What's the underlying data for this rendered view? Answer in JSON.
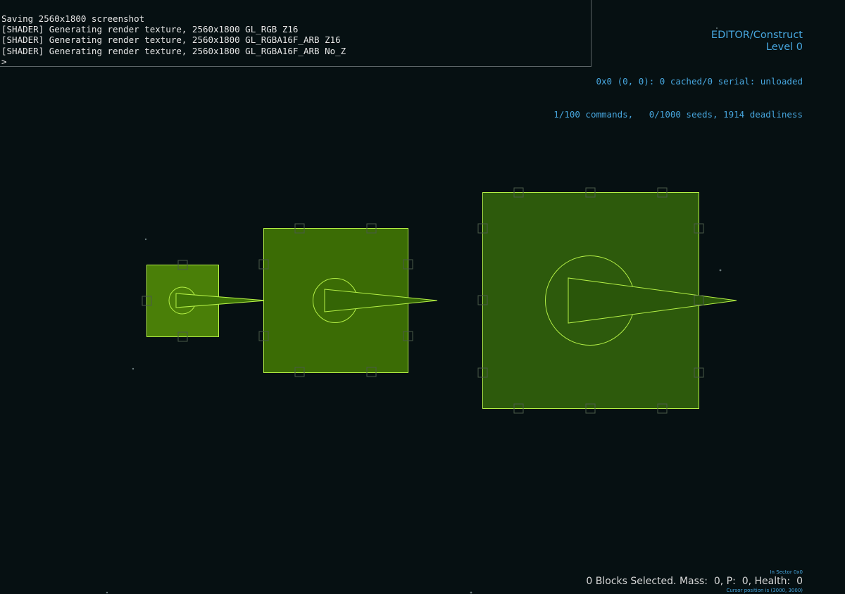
{
  "console": {
    "lines": [
      "Saving 2560x1800 screenshot",
      "[SHADER] Generating render texture, 2560x1800 GL_RGB Z16",
      "[SHADER] Generating render texture, 2560x1800 GL_RGBA16F_ARB Z16",
      "[SHADER] Generating render texture, 2560x1800 GL_RGBA16F_ARB No_Z"
    ],
    "prompt": ">"
  },
  "hud": {
    "mode": "EDITOR/Construct",
    "level": "Level 0",
    "stats_line1": "0x0 (0, 0): 0 cached/0 serial: unloaded",
    "stats_line2": "1/100 commands,   0/1000 seeds, 1914 deadliness"
  },
  "status": {
    "sector": "In Sector 0x0",
    "selection": "0 Blocks Selected. Mass:  0, P:  0, Health:  0",
    "cursor": "Cursor position is (3000, 3000)"
  },
  "colors": {
    "background": "#061012",
    "block_fill_small": "#4a7f08",
    "block_fill_medium": "#3b6c05",
    "block_fill_large": "#2d5a0c",
    "block_outline": "#b4f046",
    "port_outline": "#4a5a48",
    "hud_text": "#47a6de",
    "console_text": "#e6e6e6"
  },
  "blocks": [
    {
      "name": "small-cannon-block",
      "size": "small"
    },
    {
      "name": "medium-cannon-block",
      "size": "medium"
    },
    {
      "name": "large-cannon-block",
      "size": "large"
    }
  ]
}
